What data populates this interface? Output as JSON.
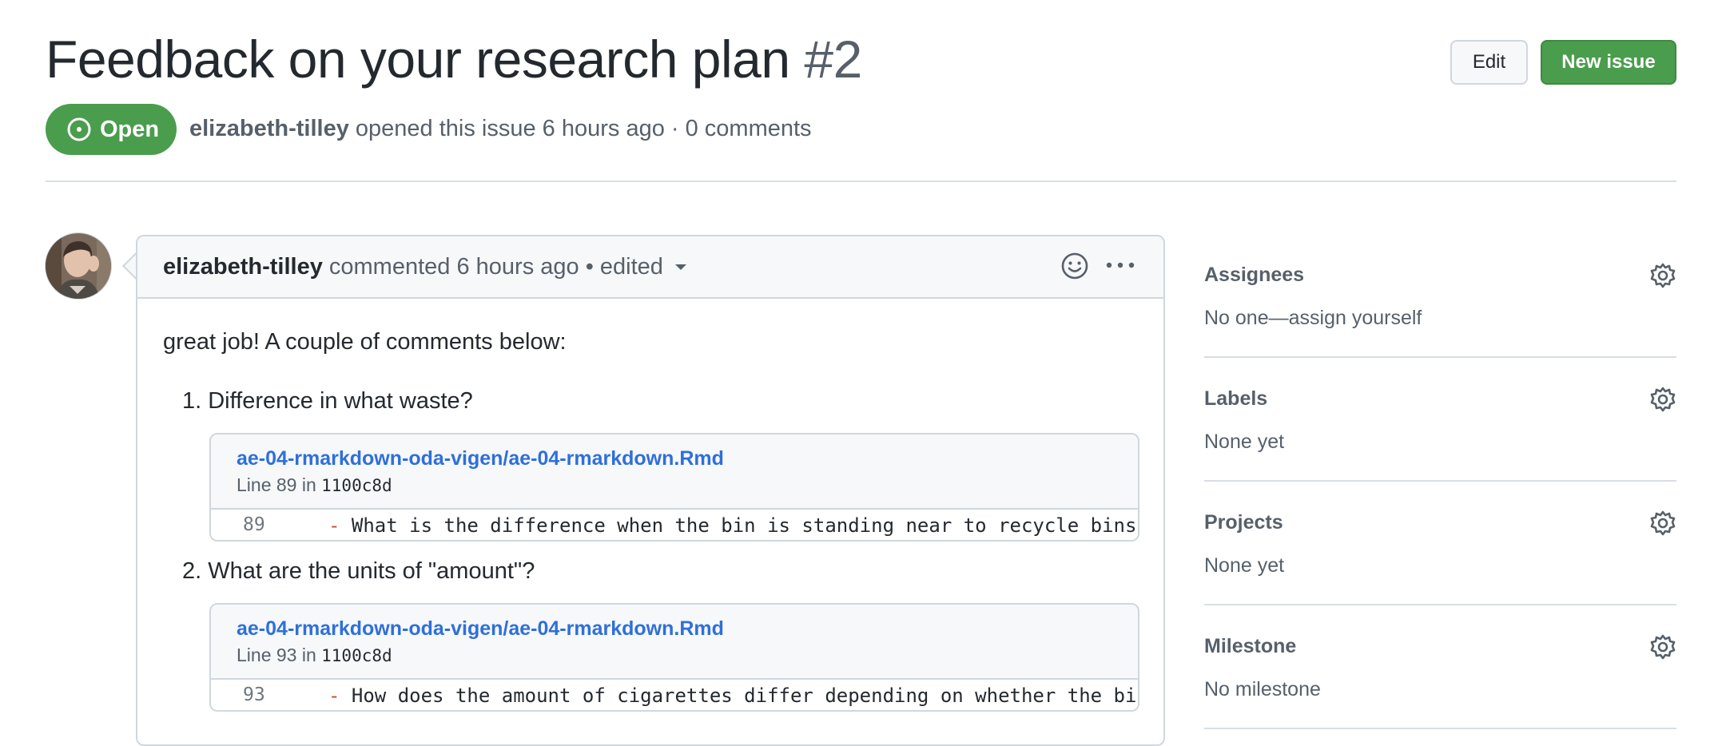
{
  "issue": {
    "title": "Feedback on your research plan",
    "number": "#2",
    "state": "Open",
    "author": "elizabeth-tilley",
    "opened_text": "opened this issue 6 hours ago · 0 comments"
  },
  "header_buttons": {
    "edit": "Edit",
    "new_issue": "New issue"
  },
  "comment": {
    "author": "elizabeth-tilley",
    "action": "commented 6 hours ago",
    "edited": "• edited",
    "intro": "great job! A couple of comments below:",
    "items": [
      {
        "text": "1. Difference in what waste?",
        "file_path": "ae-04-rmarkdown-oda-vigen/ae-04-rmarkdown.Rmd",
        "line_label": "Line 89 in",
        "sha": "1100c8d",
        "line_number": "89",
        "code_dash": "-",
        "code": "What is the difference when the bin is standing near to recycle bins"
      },
      {
        "text": "2. What are the units of \"amount\"?",
        "file_path": "ae-04-rmarkdown-oda-vigen/ae-04-rmarkdown.Rmd",
        "line_label": "Line 93 in",
        "sha": "1100c8d",
        "line_number": "93",
        "code_dash": "-",
        "code": "How does the amount of cigarettes differ depending on whether the bin"
      }
    ]
  },
  "sidebar": {
    "assignees": {
      "title": "Assignees",
      "value": "No one—assign yourself"
    },
    "labels": {
      "title": "Labels",
      "value": "None yet"
    },
    "projects": {
      "title": "Projects",
      "value": "None yet"
    },
    "milestone": {
      "title": "Milestone",
      "value": "No milestone"
    }
  },
  "colors": {
    "open_green": "#4a9d4d",
    "link_blue": "#2f6fdb",
    "border": "#d0d7de"
  }
}
